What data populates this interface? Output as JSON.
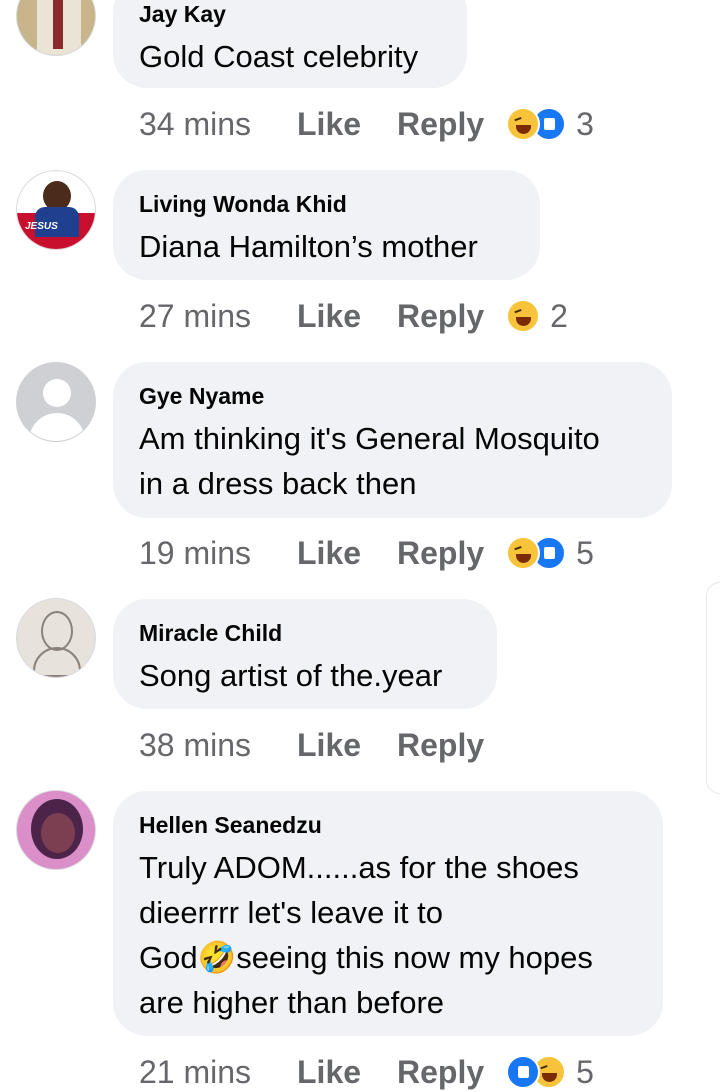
{
  "comments": [
    {
      "name": "Jay Kay",
      "lines": [
        "Gold Coast celebrity"
      ],
      "time": "34 mins",
      "like_label": "Like",
      "reply_label": "Reply",
      "reactions": [
        "haha-icon",
        "like-icon"
      ],
      "count": "3"
    },
    {
      "name": "Living Wonda Khid",
      "lines": [
        "Diana Hamilton’s mother"
      ],
      "time": "27 mins",
      "like_label": "Like",
      "reply_label": "Reply",
      "reactions": [
        "haha-icon"
      ],
      "count": "2"
    },
    {
      "name": "Gye Nyame",
      "lines": [
        "Am thinking it's General Mosquito",
        "in a dress back then"
      ],
      "time": "19 mins",
      "like_label": "Like",
      "reply_label": "Reply",
      "reactions": [
        "haha-icon",
        "like-icon"
      ],
      "count": "5"
    },
    {
      "name": "Miracle Child",
      "lines": [
        "Song artist of the.year"
      ],
      "time": "38 mins",
      "like_label": "Like",
      "reply_label": "Reply",
      "reactions": [],
      "count": ""
    },
    {
      "name": "Hellen Seanedzu",
      "lines": [
        "Truly ADOM......as for the shoes",
        "dieerrrr let's leave it to",
        "God🤣seeing this now my hopes",
        "are higher than before"
      ],
      "time": "21 mins",
      "like_label": "Like",
      "reply_label": "Reply",
      "reactions": [
        "like-icon",
        "haha-icon"
      ],
      "count": "5"
    }
  ],
  "avatar_text": {
    "living_wonda": "JESUS"
  },
  "colors": {
    "bubble": "#f0f2f5",
    "meta": "#65676b",
    "like_blue": "#1877f2",
    "haha_yellow": "#f7c33a"
  }
}
